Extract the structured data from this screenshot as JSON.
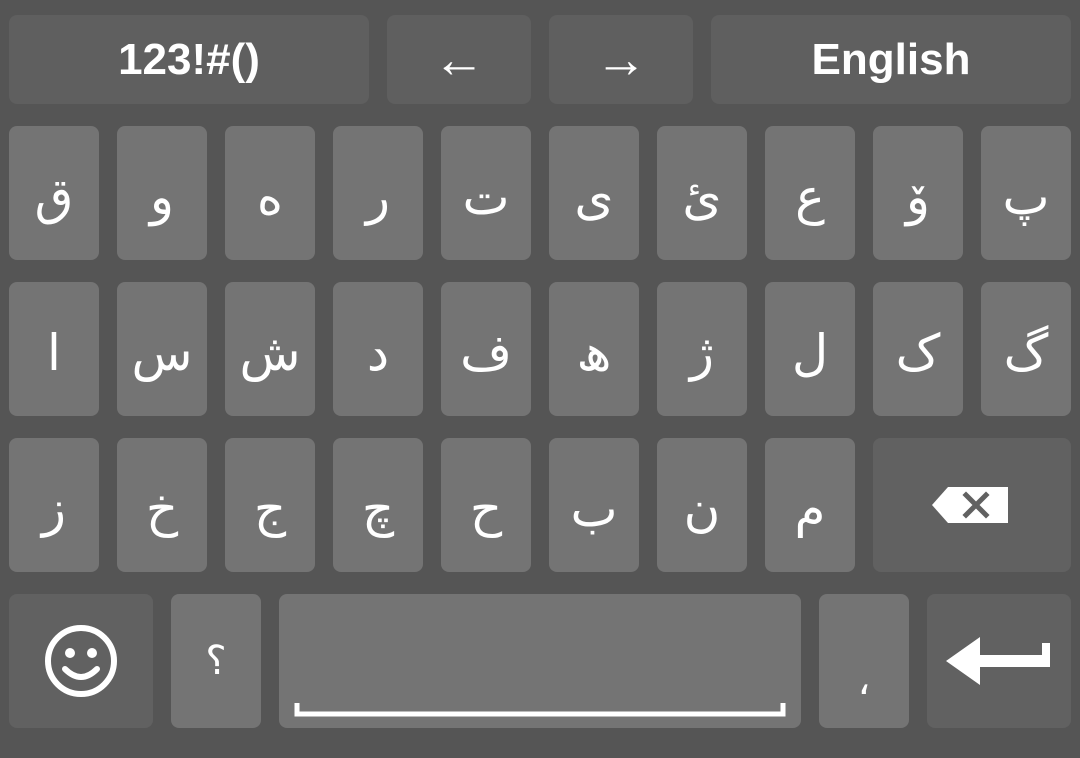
{
  "top_row": {
    "symbols_label": "123!#()",
    "left_arrow": "←",
    "right_arrow": "→",
    "language_label": "English"
  },
  "rows": {
    "row1": [
      "ق",
      "و",
      "ە",
      "ر",
      "ت",
      "ى",
      "ئ",
      "ع",
      "ۆ",
      "پ"
    ],
    "row2": [
      "ا",
      "س",
      "ش",
      "د",
      "ف",
      "ھ",
      "ژ",
      "ل",
      "ک",
      "گ"
    ],
    "row3": [
      "ز",
      "خ",
      "ج",
      "چ",
      "ح",
      "ب",
      "ن",
      "م"
    ]
  },
  "bottom_row": {
    "question_mark": "؟",
    "comma": "،"
  },
  "icons": {
    "backspace": "backspace-icon",
    "emoji": "emoji-icon",
    "enter": "enter-icon",
    "space": "space-bar-icon"
  },
  "colors": {
    "background": "#555555",
    "key_light": "#747474",
    "key_dark": "#616161",
    "text": "#ffffff"
  }
}
